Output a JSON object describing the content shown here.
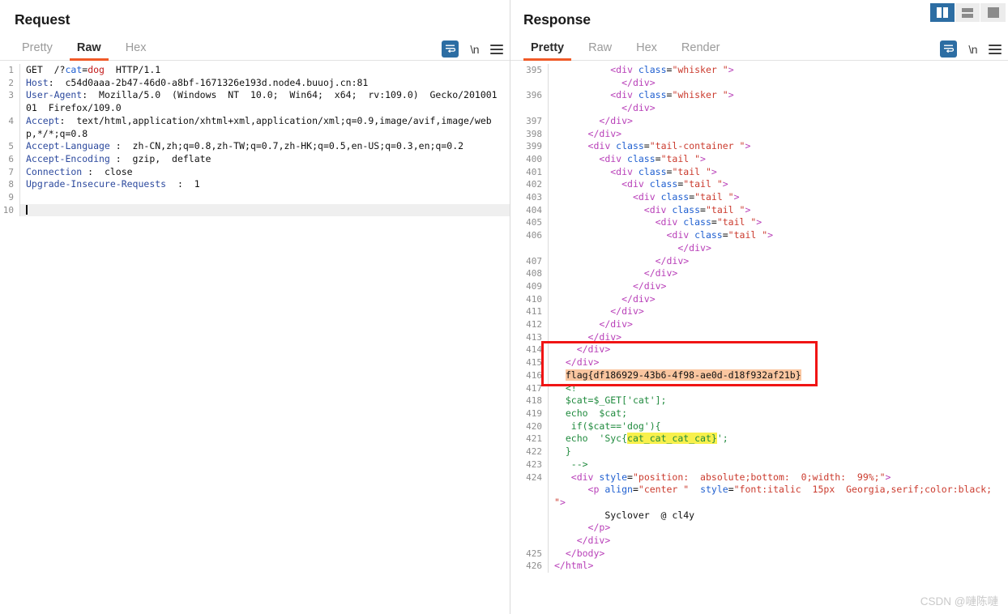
{
  "window": {
    "layout_buttons": [
      {
        "name": "vertical-split",
        "active": true
      },
      {
        "name": "horizontal-split",
        "active": false
      },
      {
        "name": "single-pane",
        "active": false
      }
    ]
  },
  "request": {
    "title": "Request",
    "tabs": [
      {
        "label": "Pretty",
        "active": false
      },
      {
        "label": "Raw",
        "active": true
      },
      {
        "label": "Hex",
        "active": false
      }
    ],
    "toolbar": {
      "wrap_icon": "word-wrap-icon",
      "newline_label": "\\n",
      "menu_icon": "hamburger-menu-icon"
    },
    "lines": [
      {
        "n": "1",
        "segments": [
          {
            "t": "GET  /?",
            "c": "plain"
          },
          {
            "t": "cat",
            "c": "param"
          },
          {
            "t": "=",
            "c": "plain"
          },
          {
            "t": "dog",
            "c": "val"
          },
          {
            "t": "  HTTP/1.1",
            "c": "plain"
          }
        ]
      },
      {
        "n": "2",
        "segments": [
          {
            "t": "Host",
            "c": "hdr"
          },
          {
            "t": ":  c54d0aaa-2b47-46d0-a8bf-1671326e193d.node4.buuoj.cn:81",
            "c": "plain"
          }
        ]
      },
      {
        "n": "3",
        "segments": [
          {
            "t": "User-Agent",
            "c": "hdr"
          },
          {
            "t": ":  Mozilla/5.0  (Windows  NT  10.0;  Win64;  x64;  rv:109.0)  Gecko/20100101  Firefox/109.0",
            "c": "plain"
          }
        ]
      },
      {
        "n": "4",
        "segments": [
          {
            "t": "Accept",
            "c": "hdr"
          },
          {
            "t": ":  text/html,application/xhtml+xml,application/xml;q=0.9,image/avif,image/webp,*/*;q=0.8",
            "c": "plain"
          }
        ]
      },
      {
        "n": "5",
        "segments": [
          {
            "t": "Accept-Language",
            "c": "hdr"
          },
          {
            "t": " :  zh-CN,zh;q=0.8,zh-TW;q=0.7,zh-HK;q=0.5,en-US;q=0.3,en;q=0.2",
            "c": "plain"
          }
        ]
      },
      {
        "n": "6",
        "segments": [
          {
            "t": "Accept-Encoding",
            "c": "hdr"
          },
          {
            "t": " :  gzip,  deflate",
            "c": "plain"
          }
        ]
      },
      {
        "n": "7",
        "segments": [
          {
            "t": "Connection",
            "c": "hdr"
          },
          {
            "t": " :  close",
            "c": "plain"
          }
        ]
      },
      {
        "n": "8",
        "segments": [
          {
            "t": "Upgrade-Insecure-Requests",
            "c": "hdr"
          },
          {
            "t": "  :  1",
            "c": "plain"
          }
        ]
      },
      {
        "n": "9",
        "segments": []
      },
      {
        "n": "10",
        "segments": [],
        "cursor": true
      }
    ]
  },
  "response": {
    "title": "Response",
    "tabs": [
      {
        "label": "Pretty",
        "active": true
      },
      {
        "label": "Raw",
        "active": false
      },
      {
        "label": "Hex",
        "active": false
      },
      {
        "label": "Render",
        "active": false
      }
    ],
    "toolbar": {
      "wrap_icon": "word-wrap-icon",
      "newline_label": "\\n",
      "menu_icon": "hamburger-menu-icon"
    },
    "annotation": {
      "type": "red-rectangle",
      "color": "#f01414",
      "covers_lines": [
        "414",
        "415",
        "416",
        "417"
      ]
    },
    "highlights": {
      "flag_highlight_color": "#fac6a0",
      "syc_highlight_color": "#f8f04c"
    },
    "lines": [
      {
        "n": "395",
        "segments": [
          {
            "t": "          ",
            "c": "txt"
          },
          {
            "t": "<div ",
            "c": "tag"
          },
          {
            "t": "class",
            "c": "attr"
          },
          {
            "t": "=",
            "c": "txt"
          },
          {
            "t": "\"whisker \"",
            "c": "attrval"
          },
          {
            "t": ">",
            "c": "tag"
          },
          {
            "t": "\n            ",
            "c": "txt"
          },
          {
            "t": "</div>",
            "c": "tag"
          }
        ]
      },
      {
        "n": "396",
        "segments": [
          {
            "t": "          ",
            "c": "txt"
          },
          {
            "t": "<div ",
            "c": "tag"
          },
          {
            "t": "class",
            "c": "attr"
          },
          {
            "t": "=",
            "c": "txt"
          },
          {
            "t": "\"whisker \"",
            "c": "attrval"
          },
          {
            "t": ">",
            "c": "tag"
          },
          {
            "t": "\n            ",
            "c": "txt"
          },
          {
            "t": "</div>",
            "c": "tag"
          }
        ]
      },
      {
        "n": "397",
        "segments": [
          {
            "t": "        ",
            "c": "txt"
          },
          {
            "t": "</div>",
            "c": "tag"
          }
        ]
      },
      {
        "n": "398",
        "segments": [
          {
            "t": "      ",
            "c": "txt"
          },
          {
            "t": "</div>",
            "c": "tag"
          }
        ]
      },
      {
        "n": "399",
        "segments": [
          {
            "t": "      ",
            "c": "txt"
          },
          {
            "t": "<div ",
            "c": "tag"
          },
          {
            "t": "class",
            "c": "attr"
          },
          {
            "t": "=",
            "c": "txt"
          },
          {
            "t": "\"tail-container \"",
            "c": "attrval"
          },
          {
            "t": ">",
            "c": "tag"
          }
        ]
      },
      {
        "n": "400",
        "segments": [
          {
            "t": "        ",
            "c": "txt"
          },
          {
            "t": "<div ",
            "c": "tag"
          },
          {
            "t": "class",
            "c": "attr"
          },
          {
            "t": "=",
            "c": "txt"
          },
          {
            "t": "\"tail \"",
            "c": "attrval"
          },
          {
            "t": ">",
            "c": "tag"
          }
        ]
      },
      {
        "n": "401",
        "segments": [
          {
            "t": "          ",
            "c": "txt"
          },
          {
            "t": "<div ",
            "c": "tag"
          },
          {
            "t": "class",
            "c": "attr"
          },
          {
            "t": "=",
            "c": "txt"
          },
          {
            "t": "\"tail \"",
            "c": "attrval"
          },
          {
            "t": ">",
            "c": "tag"
          }
        ]
      },
      {
        "n": "402",
        "segments": [
          {
            "t": "            ",
            "c": "txt"
          },
          {
            "t": "<div ",
            "c": "tag"
          },
          {
            "t": "class",
            "c": "attr"
          },
          {
            "t": "=",
            "c": "txt"
          },
          {
            "t": "\"tail \"",
            "c": "attrval"
          },
          {
            "t": ">",
            "c": "tag"
          }
        ]
      },
      {
        "n": "403",
        "segments": [
          {
            "t": "              ",
            "c": "txt"
          },
          {
            "t": "<div ",
            "c": "tag"
          },
          {
            "t": "class",
            "c": "attr"
          },
          {
            "t": "=",
            "c": "txt"
          },
          {
            "t": "\"tail \"",
            "c": "attrval"
          },
          {
            "t": ">",
            "c": "tag"
          }
        ]
      },
      {
        "n": "404",
        "segments": [
          {
            "t": "                ",
            "c": "txt"
          },
          {
            "t": "<div ",
            "c": "tag"
          },
          {
            "t": "class",
            "c": "attr"
          },
          {
            "t": "=",
            "c": "txt"
          },
          {
            "t": "\"tail \"",
            "c": "attrval"
          },
          {
            "t": ">",
            "c": "tag"
          }
        ]
      },
      {
        "n": "405",
        "segments": [
          {
            "t": "                  ",
            "c": "txt"
          },
          {
            "t": "<div ",
            "c": "tag"
          },
          {
            "t": "class",
            "c": "attr"
          },
          {
            "t": "=",
            "c": "txt"
          },
          {
            "t": "\"tail \"",
            "c": "attrval"
          },
          {
            "t": ">",
            "c": "tag"
          }
        ]
      },
      {
        "n": "406",
        "segments": [
          {
            "t": "                    ",
            "c": "txt"
          },
          {
            "t": "<div ",
            "c": "tag"
          },
          {
            "t": "class",
            "c": "attr"
          },
          {
            "t": "=",
            "c": "txt"
          },
          {
            "t": "\"tail \"",
            "c": "attrval"
          },
          {
            "t": ">",
            "c": "tag"
          },
          {
            "t": "\n                      ",
            "c": "txt"
          },
          {
            "t": "</div>",
            "c": "tag"
          }
        ]
      },
      {
        "n": "407",
        "segments": [
          {
            "t": "                  ",
            "c": "txt"
          },
          {
            "t": "</div>",
            "c": "tag"
          }
        ]
      },
      {
        "n": "408",
        "segments": [
          {
            "t": "                ",
            "c": "txt"
          },
          {
            "t": "</div>",
            "c": "tag"
          }
        ]
      },
      {
        "n": "409",
        "segments": [
          {
            "t": "              ",
            "c": "txt"
          },
          {
            "t": "</div>",
            "c": "tag"
          }
        ]
      },
      {
        "n": "410",
        "segments": [
          {
            "t": "            ",
            "c": "txt"
          },
          {
            "t": "</div>",
            "c": "tag"
          }
        ]
      },
      {
        "n": "411",
        "segments": [
          {
            "t": "          ",
            "c": "txt"
          },
          {
            "t": "</div>",
            "c": "tag"
          }
        ]
      },
      {
        "n": "412",
        "segments": [
          {
            "t": "        ",
            "c": "txt"
          },
          {
            "t": "</div>",
            "c": "tag"
          }
        ]
      },
      {
        "n": "413",
        "segments": [
          {
            "t": "      ",
            "c": "txt"
          },
          {
            "t": "</div>",
            "c": "tag"
          }
        ]
      },
      {
        "n": "414",
        "segments": [
          {
            "t": "    ",
            "c": "txt"
          },
          {
            "t": "</div>",
            "c": "tag"
          }
        ]
      },
      {
        "n": "415",
        "segments": [
          {
            "t": "  ",
            "c": "txt"
          },
          {
            "t": "</div>",
            "c": "tag"
          }
        ]
      },
      {
        "n": "416",
        "segments": [
          {
            "t": "  ",
            "c": "txt"
          },
          {
            "t": "flag{df186929-43b6-4f98-ae0d-d18f932af21b}",
            "c": "txt",
            "hl": "orange"
          }
        ]
      },
      {
        "n": "417",
        "segments": [
          {
            "t": "  <!",
            "c": "php"
          }
        ]
      },
      {
        "n": "418",
        "segments": [
          {
            "t": "  $cat=$_GET['cat'];",
            "c": "php"
          }
        ]
      },
      {
        "n": "419",
        "segments": [
          {
            "t": "  echo  $cat;",
            "c": "php"
          }
        ]
      },
      {
        "n": "420",
        "segments": [
          {
            "t": "   if($cat=='dog'){",
            "c": "php"
          }
        ]
      },
      {
        "n": "421",
        "segments": [
          {
            "t": "  echo  'Syc{",
            "c": "php"
          },
          {
            "t": "cat_cat_cat_cat}",
            "c": "php",
            "hl": "yellow"
          },
          {
            "t": "';",
            "c": "php"
          }
        ]
      },
      {
        "n": "422",
        "segments": [
          {
            "t": "  }",
            "c": "php"
          }
        ]
      },
      {
        "n": "423",
        "segments": [
          {
            "t": "   -->",
            "c": "php"
          }
        ]
      },
      {
        "n": "424",
        "segments": [
          {
            "t": "   ",
            "c": "txt"
          },
          {
            "t": "<div ",
            "c": "tag"
          },
          {
            "t": "style",
            "c": "attr"
          },
          {
            "t": "=",
            "c": "txt"
          },
          {
            "t": "\"position:  absolute;bottom:  0;width:  99%;\"",
            "c": "attrval"
          },
          {
            "t": ">",
            "c": "tag"
          },
          {
            "t": "\n      ",
            "c": "txt"
          },
          {
            "t": "<p ",
            "c": "tag"
          },
          {
            "t": "align",
            "c": "attr"
          },
          {
            "t": "=",
            "c": "txt"
          },
          {
            "t": "\"center \"",
            "c": "attrval"
          },
          {
            "t": "  ",
            "c": "txt"
          },
          {
            "t": "style",
            "c": "attr"
          },
          {
            "t": "=",
            "c": "txt"
          },
          {
            "t": "\"font:italic  15px  Georgia,serif;color:black;  \"",
            "c": "attrval"
          },
          {
            "t": ">",
            "c": "tag"
          },
          {
            "t": "\n         Syclover  @ cl4y\n      ",
            "c": "txt"
          },
          {
            "t": "</p>",
            "c": "tag"
          },
          {
            "t": "\n    ",
            "c": "txt"
          },
          {
            "t": "</div>",
            "c": "tag"
          }
        ]
      },
      {
        "n": "425",
        "segments": [
          {
            "t": "  ",
            "c": "txt"
          },
          {
            "t": "</body>",
            "c": "tag"
          }
        ]
      },
      {
        "n": "426",
        "segments": [
          {
            "t": "</html>",
            "c": "tag"
          }
        ]
      }
    ]
  },
  "watermark": "CSDN @嗹陈嗹"
}
